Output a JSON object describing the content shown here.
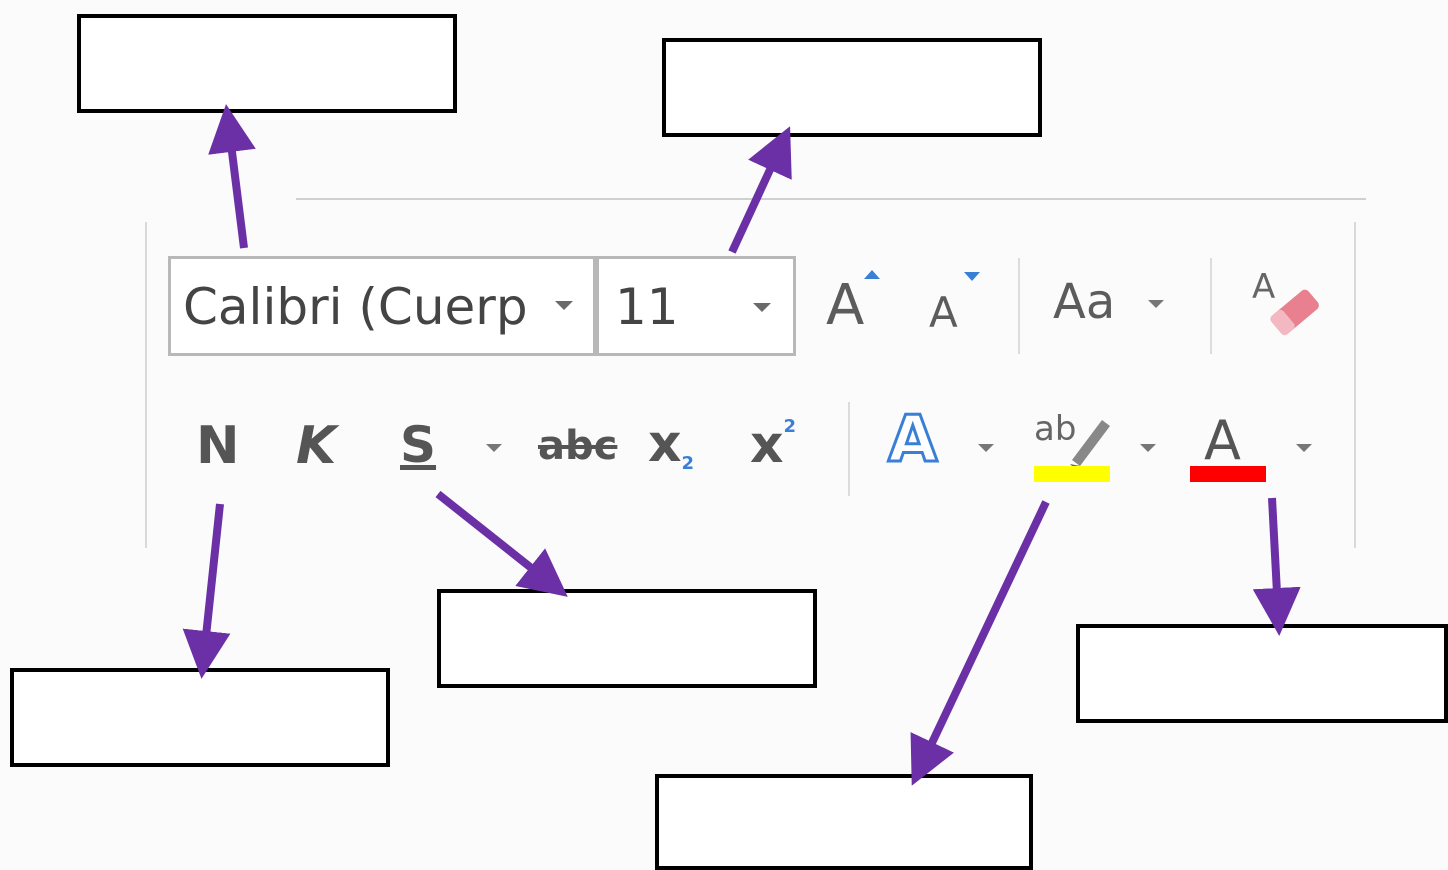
{
  "font_group": {
    "font_name": "Calibri (Cuerpo",
    "font_size": "11",
    "grow_font_glyph": "A",
    "shrink_font_glyph": "A",
    "change_case_glyph": "Aa",
    "clear_format_glyph": "A"
  },
  "format_row": {
    "bold_glyph": "N",
    "italic_glyph": "K",
    "underline_glyph": "S",
    "strikethrough_glyph": "abc",
    "subscript_glyph": "x",
    "subscript_small": "2",
    "superscript_glyph": "x",
    "superscript_small": "2",
    "text_effects_glyph": "A",
    "highlight_glyph": "ab",
    "font_color_glyph": "A"
  },
  "colors": {
    "arrow": "#6b2fa6",
    "highlight_bar": "#ffff00",
    "font_color_bar": "#ff0000",
    "text_effects": "#3a7fd6"
  },
  "labels": {
    "box1": "",
    "box2": "",
    "box3": "",
    "box4": "",
    "box5": "",
    "box6": ""
  }
}
